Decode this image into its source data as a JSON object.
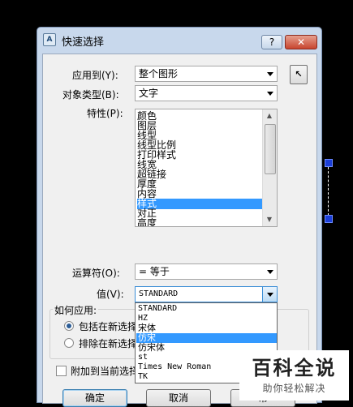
{
  "window": {
    "title": "快速选择",
    "icon_text": "A",
    "help_label": "?",
    "close_label": "✕"
  },
  "form": {
    "apply_to": {
      "label": "应用到(Y):",
      "value": "整个图形"
    },
    "object_type": {
      "label": "对象类型(B):",
      "value": "文字"
    },
    "properties": {
      "label": "特性(P):",
      "items": [
        "颜色",
        "图层",
        "线型",
        "线型比例",
        "打印样式",
        "线宽",
        "超链接",
        "厚度",
        "内容",
        "样式",
        "对正",
        "高度"
      ],
      "selected": "样式"
    },
    "operator": {
      "label": "运算符(O):",
      "value": "= 等于"
    },
    "value": {
      "label": "值(V):",
      "value": "STANDARD",
      "options": [
        "STANDARD",
        "HZ",
        "宋体",
        "仿宋",
        "仿宋体",
        "st",
        "Times New Roman",
        "TK"
      ],
      "highlighted": "仿宋"
    },
    "how_to_apply": {
      "legend": "如何应用:",
      "include_label": "包括在新选择",
      "exclude_label": "排除在新选择",
      "selected": "include"
    },
    "append_label": "附加到当前选择"
  },
  "buttons": {
    "ok": "确定",
    "cancel": "取消",
    "help_partial": "帮"
  },
  "watermark": {
    "title": "百科全说",
    "subtitle": "助你轻松解决"
  },
  "colors": {
    "selection": "#3399ff",
    "title_bar": "#c8d8ec",
    "grip": "#1c3fd8"
  }
}
